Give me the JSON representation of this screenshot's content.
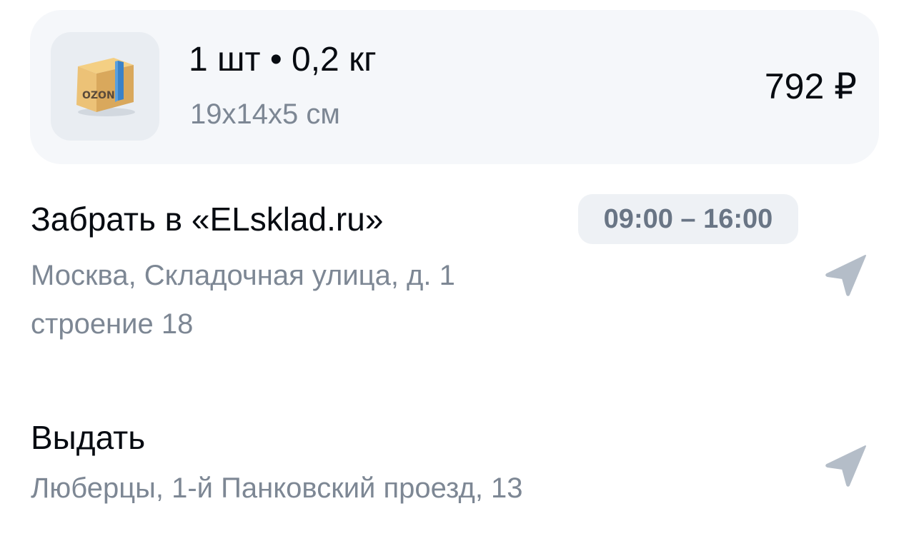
{
  "parcel": {
    "logo_text": "OZON",
    "quantity_weight": "1 шт • 0,2 кг",
    "dimensions": "19х14х5 см",
    "price": "792 ₽"
  },
  "pickup": {
    "title": "Забрать в «ELsklad.ru»",
    "time": "09:00 – 16:00",
    "address_line1": "Москва, Складочная улица, д. 1",
    "address_line2": "строение 18",
    "icon": "navigation-arrow-icon"
  },
  "delivery": {
    "title": "Выдать",
    "address": "Люберцы, 1-й Панковский проезд, 13",
    "icon": "navigation-arrow-icon"
  },
  "colors": {
    "card_bg": "#f5f7fa",
    "primary_text": "#070b11",
    "secondary_text": "#7d8794",
    "badge_bg": "#eef1f5",
    "icon": "#b4bdc8"
  }
}
